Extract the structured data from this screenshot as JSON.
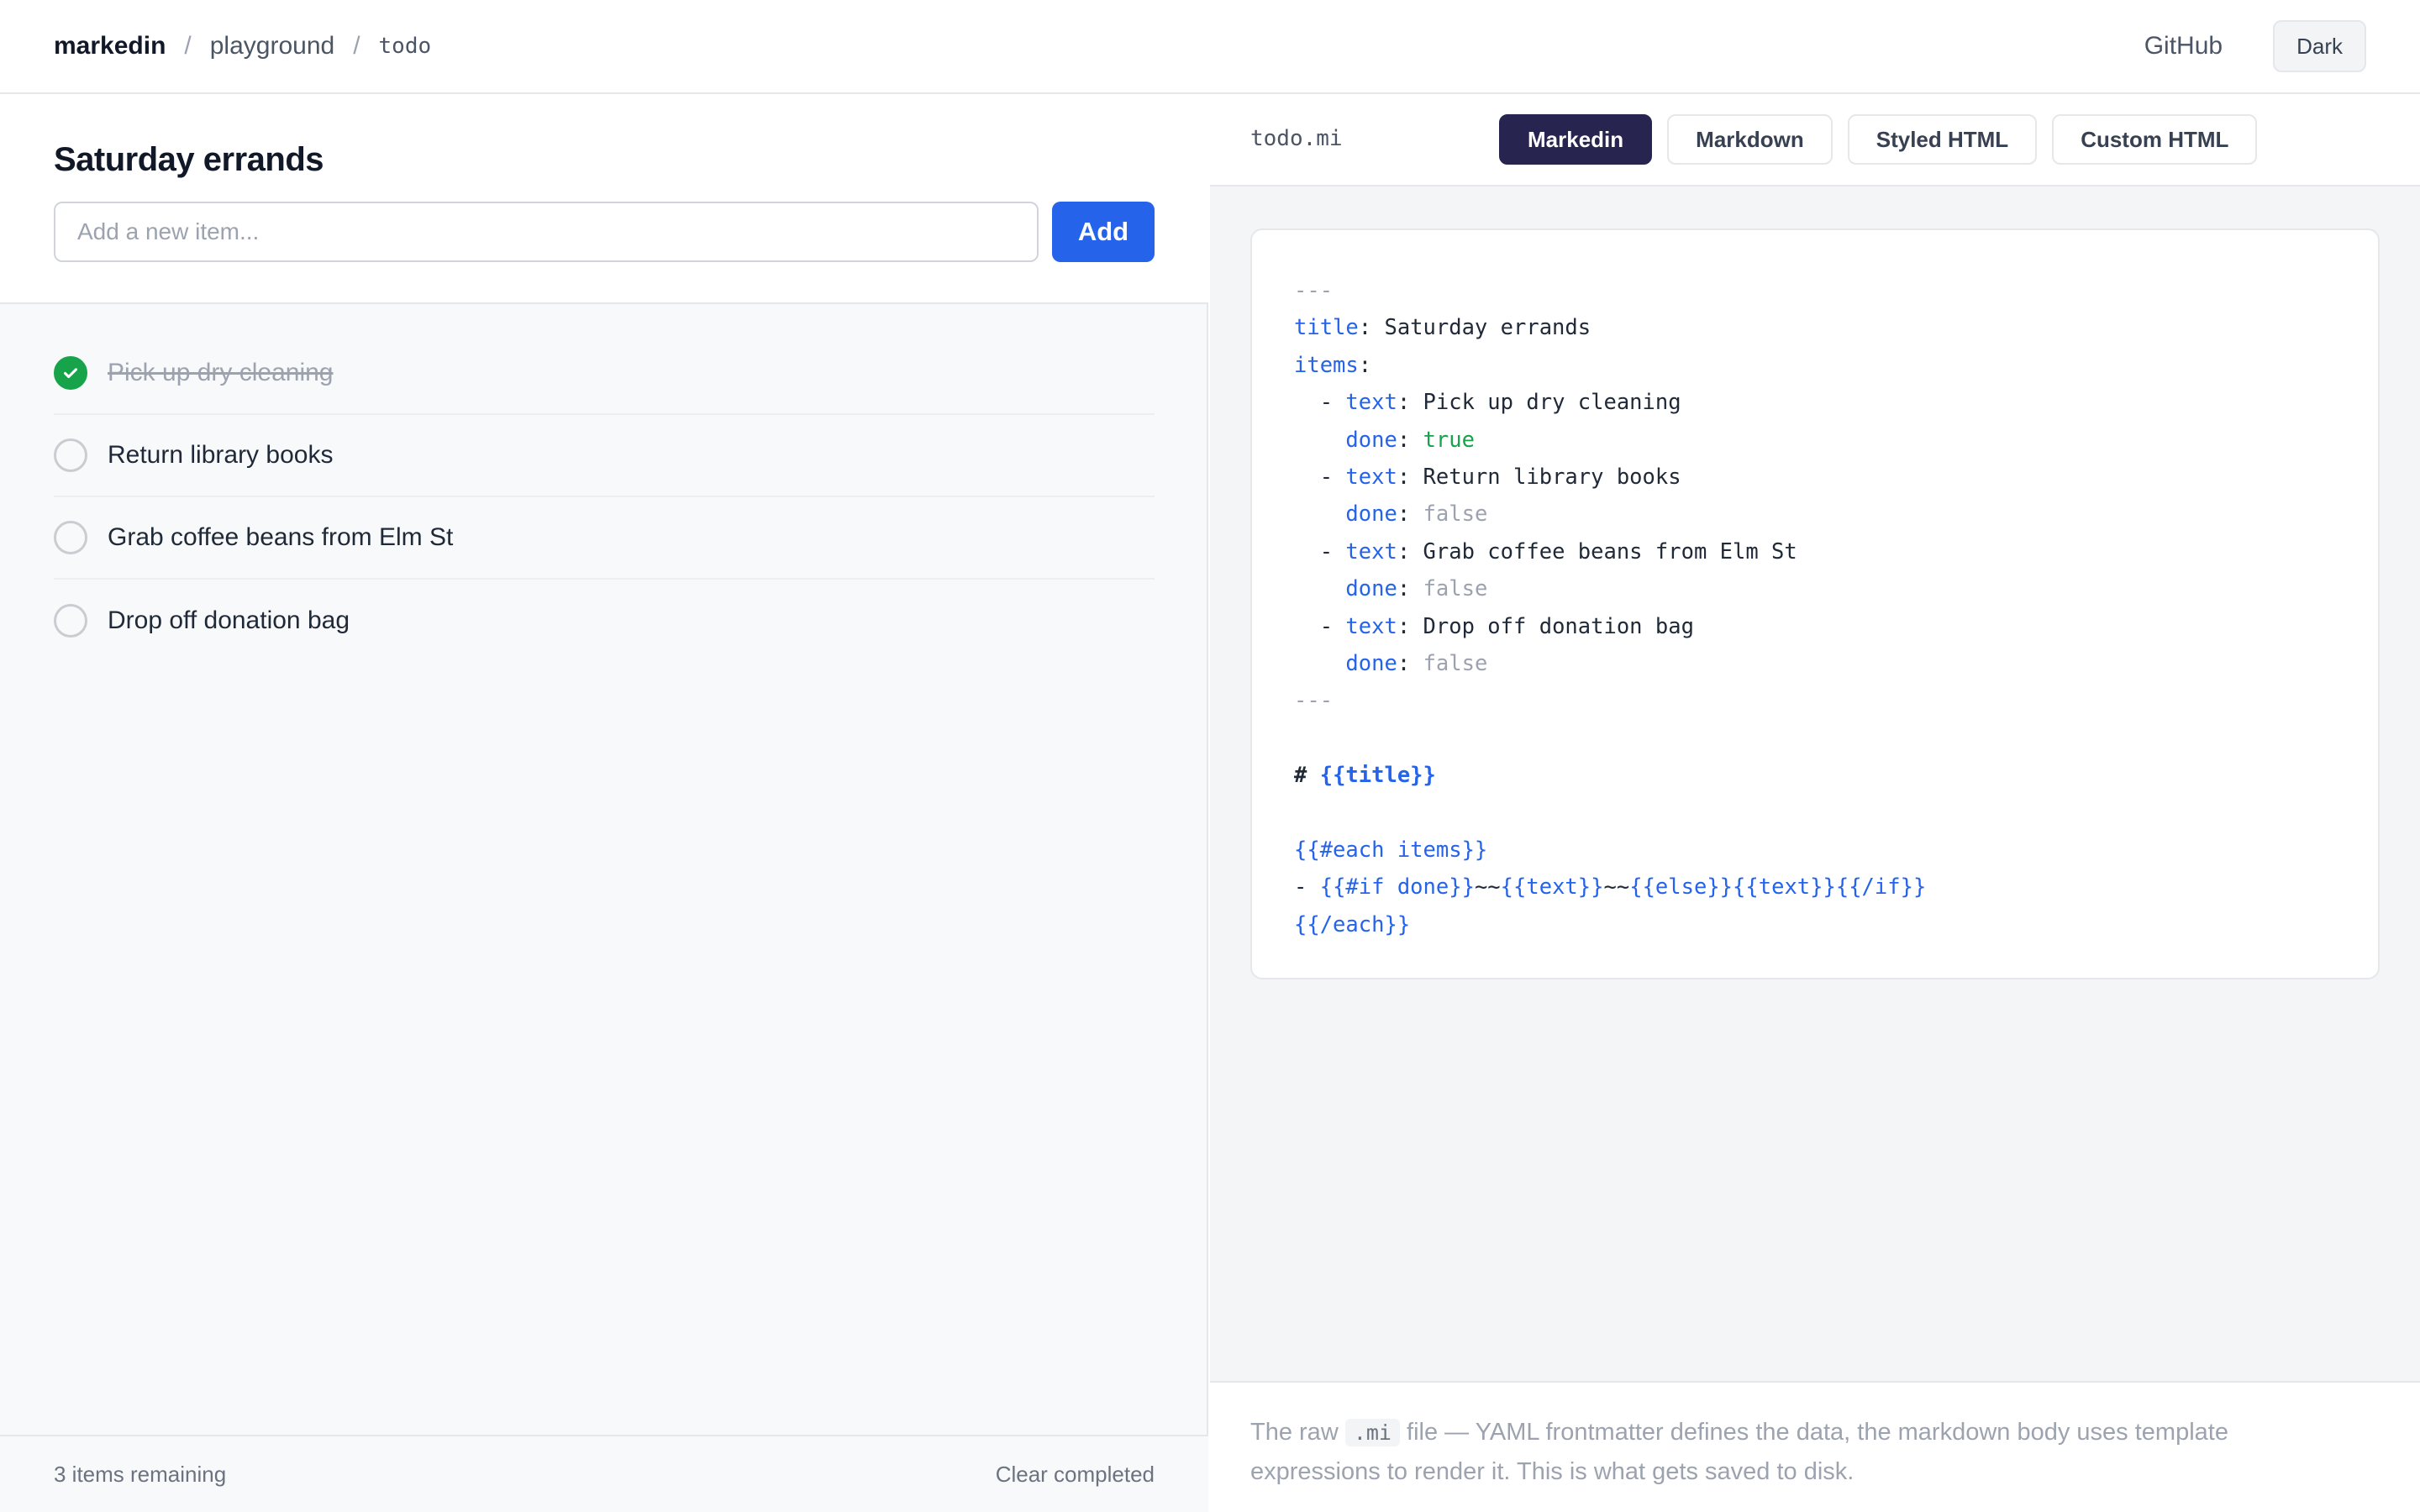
{
  "header": {
    "brand": "markedin",
    "crumbs": [
      "playground",
      "todo"
    ],
    "separator": "/",
    "github_label": "GitHub",
    "theme_label": "Dark"
  },
  "todo": {
    "title": "Saturday errands",
    "input_placeholder": "Add a new item...",
    "add_label": "Add",
    "items": [
      {
        "text": "Pick up dry cleaning",
        "done": true
      },
      {
        "text": "Return library books",
        "done": false
      },
      {
        "text": "Grab coffee beans from Elm St",
        "done": false
      },
      {
        "text": "Drop off donation bag",
        "done": false
      }
    ],
    "remaining_label": "3 items remaining",
    "clear_label": "Clear completed"
  },
  "editor": {
    "file_name": "todo.mi",
    "tabs": [
      {
        "label": "Markedin",
        "active": true
      },
      {
        "label": "Markdown",
        "active": false
      },
      {
        "label": "Styled HTML",
        "active": false
      },
      {
        "label": "Custom HTML",
        "active": false
      }
    ],
    "code_lines": [
      [
        {
          "t": "---",
          "c": "dash"
        }
      ],
      [
        {
          "t": "title",
          "c": "key"
        },
        {
          "t": ": Saturday errands",
          "c": "val"
        }
      ],
      [
        {
          "t": "items",
          "c": "key"
        },
        {
          "t": ":",
          "c": "val"
        }
      ],
      [
        {
          "t": "  - ",
          "c": "val"
        },
        {
          "t": "text",
          "c": "key"
        },
        {
          "t": ": Pick up dry cleaning",
          "c": "val"
        }
      ],
      [
        {
          "t": "    ",
          "c": "val"
        },
        {
          "t": "done",
          "c": "key"
        },
        {
          "t": ": ",
          "c": "val"
        },
        {
          "t": "true",
          "c": "true"
        }
      ],
      [
        {
          "t": "  - ",
          "c": "val"
        },
        {
          "t": "text",
          "c": "key"
        },
        {
          "t": ": Return library books",
          "c": "val"
        }
      ],
      [
        {
          "t": "    ",
          "c": "val"
        },
        {
          "t": "done",
          "c": "key"
        },
        {
          "t": ": ",
          "c": "val"
        },
        {
          "t": "false",
          "c": "false"
        }
      ],
      [
        {
          "t": "  - ",
          "c": "val"
        },
        {
          "t": "text",
          "c": "key"
        },
        {
          "t": ": Grab coffee beans from Elm St",
          "c": "val"
        }
      ],
      [
        {
          "t": "    ",
          "c": "val"
        },
        {
          "t": "done",
          "c": "key"
        },
        {
          "t": ": ",
          "c": "val"
        },
        {
          "t": "false",
          "c": "false"
        }
      ],
      [
        {
          "t": "  - ",
          "c": "val"
        },
        {
          "t": "text",
          "c": "key"
        },
        {
          "t": ": Drop off donation bag",
          "c": "val"
        }
      ],
      [
        {
          "t": "    ",
          "c": "val"
        },
        {
          "t": "done",
          "c": "key"
        },
        {
          "t": ": ",
          "c": "val"
        },
        {
          "t": "false",
          "c": "false"
        }
      ],
      [
        {
          "t": "---",
          "c": "dash"
        }
      ],
      [],
      [
        {
          "t": "# ",
          "c": "val strong"
        },
        {
          "t": "{{title}}",
          "c": "tpl strong"
        }
      ],
      [],
      [
        {
          "t": "{{#each items}}",
          "c": "tpl"
        }
      ],
      [
        {
          "t": "- ",
          "c": "val"
        },
        {
          "t": "{{#if done}}",
          "c": "tpl"
        },
        {
          "t": "~~",
          "c": "val"
        },
        {
          "t": "{{text}}",
          "c": "tpl"
        },
        {
          "t": "~~",
          "c": "val"
        },
        {
          "t": "{{else}}{{text}}{{/if}}",
          "c": "tpl"
        }
      ],
      [
        {
          "t": "{{/each}}",
          "c": "tpl"
        }
      ]
    ],
    "caption_before": "The raw ",
    "caption_code": ".mi",
    "caption_after": " file — YAML frontmatter defines the data, the markdown body uses template expressions to render it. This is what gets saved to disk."
  },
  "colors": {
    "accent": "#2563eb",
    "tab_active": "#272550",
    "done_green": "#16a34a"
  },
  "icons": {
    "done": "check-circle-icon",
    "pending": "circle-icon"
  }
}
